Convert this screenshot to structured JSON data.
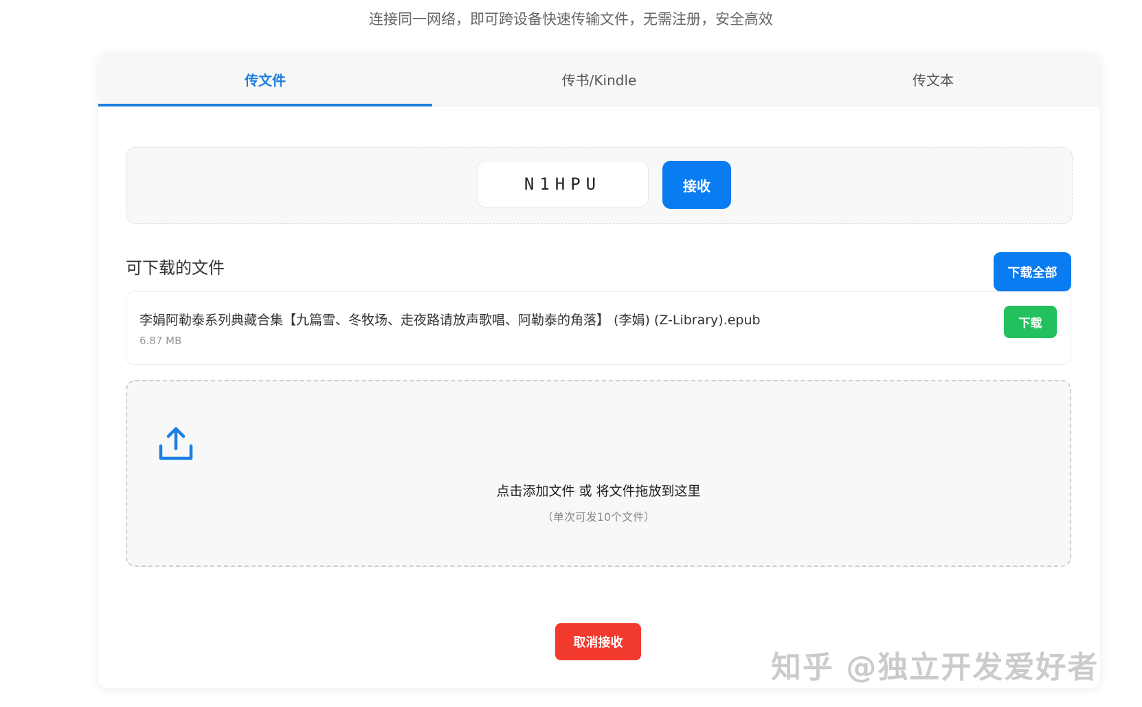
{
  "header": {
    "subtitle": "连接同一网络，即可跨设备快速传输文件，无需注册，安全高效"
  },
  "tabs": [
    {
      "label": "传文件",
      "active": true
    },
    {
      "label": "传书/Kindle",
      "active": false
    },
    {
      "label": "传文本",
      "active": false
    }
  ],
  "receive": {
    "code_value": "N1HPU",
    "button_label": "接收"
  },
  "downloads": {
    "section_title": "可下载的文件",
    "download_all_label": "下载全部",
    "files": [
      {
        "name": "李娟阿勒泰系列典藏合集【九篇雪、冬牧场、走夜路请放声歌唱、阿勒泰的角落】 (李娟) (Z-Library).epub",
        "size": "6.87 MB",
        "download_label": "下载"
      }
    ]
  },
  "drop_zone": {
    "icon": "upload-icon",
    "text": "点击添加文件 或 将文件拖放到这里",
    "hint": "（单次可发10个文件）"
  },
  "cancel_label": "取消接收",
  "watermark": "知乎 @独立开发爱好者",
  "colors": {
    "accent": "#0a7cf2",
    "success": "#22c15d",
    "danger": "#f23a2f"
  }
}
